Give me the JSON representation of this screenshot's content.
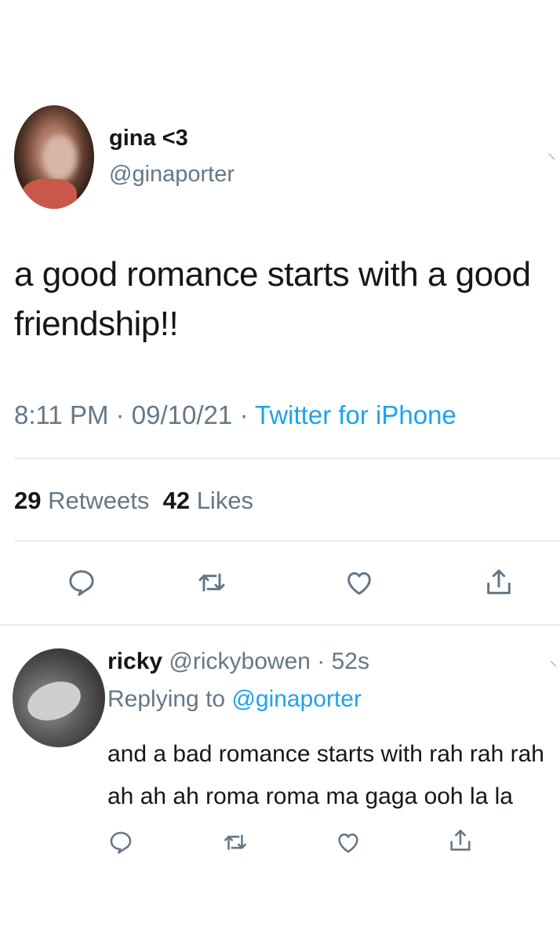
{
  "tweet": {
    "author": {
      "display_name": "gina <3",
      "handle": "@ginaporter"
    },
    "text": "a good romance starts with a good\nfriendship!!",
    "time": "8:11 PM",
    "date": "09/10/21",
    "source": "Twitter for iPhone",
    "stats": {
      "retweets_count": "29",
      "retweets_label": "Retweets",
      "likes_count": "42",
      "likes_label": "Likes"
    },
    "actions": [
      "reply-icon",
      "retweet-icon",
      "like-icon",
      "share-icon"
    ]
  },
  "reply": {
    "author": {
      "display_name": "ricky",
      "handle": "@rickybowen",
      "time": "52s"
    },
    "replying_to_prefix": "Replying to",
    "replying_to_handle": "@ginaporter",
    "text": "and a bad romance starts with rah rah rah\nah ah ah roma roma ma gaga ooh la la",
    "actions": [
      "reply-icon",
      "retweet-icon",
      "like-icon",
      "share-icon"
    ]
  },
  "colors": {
    "text": "#14171a",
    "muted": "#657786",
    "link": "#1da1f2",
    "divider": "#e6ecf0",
    "background": "#ffffff"
  }
}
